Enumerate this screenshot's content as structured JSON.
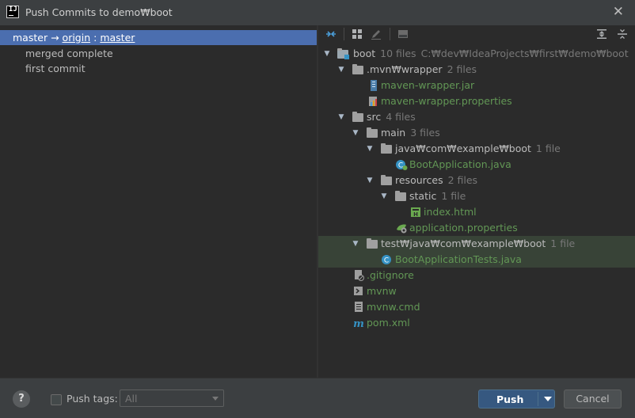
{
  "window": {
    "title": "Push Commits to demo₩boot"
  },
  "commits": {
    "branch_local": "master",
    "branch_arrow": "→",
    "branch_remote": "origin",
    "branch_sep": ":",
    "branch_target": "master",
    "items": [
      "merged complete",
      "first commit"
    ]
  },
  "tree": {
    "root": {
      "label": "boot",
      "count": "10 files",
      "path": "C:₩dev₩IdeaProjects₩first₩demo₩boot"
    },
    "mvn": {
      "label": ".mvn₩wrapper",
      "count": "2 files"
    },
    "maven_jar": "maven-wrapper.jar",
    "maven_props": "maven-wrapper.properties",
    "src": {
      "label": "src",
      "count": "4 files"
    },
    "main": {
      "label": "main",
      "count": "3 files"
    },
    "java_pkg": {
      "label": "java₩com₩example₩boot",
      "count": "1 file"
    },
    "boot_app": "BootApplication.java",
    "resources": {
      "label": "resources",
      "count": "2 files"
    },
    "static": {
      "label": "static",
      "count": "1 file"
    },
    "index_html": "index.html",
    "app_props": "application.properties",
    "test_pkg": {
      "label": "test₩java₩com₩example₩boot",
      "count": "1 file"
    },
    "boot_tests": "BootApplicationTests.java",
    "gitignore": ".gitignore",
    "mvnw": "mvnw",
    "mvnw_cmd": "mvnw.cmd",
    "pom": "pom.xml"
  },
  "bottom": {
    "help": "?",
    "push_tags_label": "Push tags:",
    "push_tags_value": "All",
    "push_button": "Push",
    "cancel_button": "Cancel"
  },
  "colors": {
    "selection": "#4b6eaf",
    "highlight_row": "#384337",
    "file_green": "#629755",
    "push_button": "#365880"
  }
}
